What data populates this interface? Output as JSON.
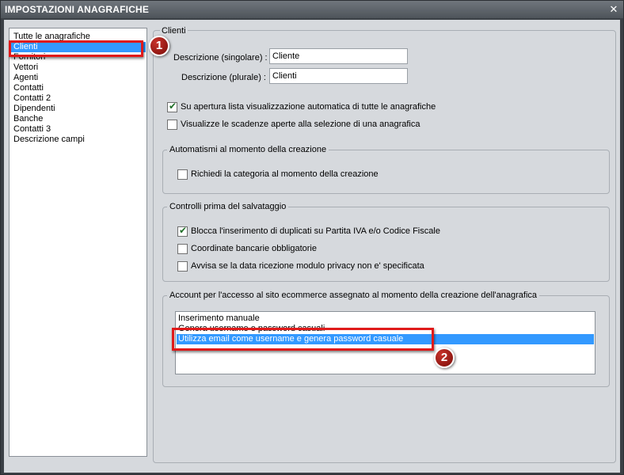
{
  "window": {
    "title": "IMPOSTAZIONI ANAGRAFICHE",
    "close_glyph": "✕"
  },
  "sidebar": {
    "items": [
      {
        "label": "Tutte le anagrafiche"
      },
      {
        "label": "Clienti",
        "selected": true
      },
      {
        "label": "Fornitori"
      },
      {
        "label": "Vettori"
      },
      {
        "label": "Agenti"
      },
      {
        "label": "Contatti"
      },
      {
        "label": "Contatti 2"
      },
      {
        "label": "Dipendenti"
      },
      {
        "label": "Banche"
      },
      {
        "label": "Contatti 3"
      },
      {
        "label": "Descrizione campi"
      }
    ]
  },
  "clienti": {
    "legend": "Clienti",
    "singolare_label": "Descrizione (singolare) :",
    "singolare_value": "Cliente",
    "plurale_label": "Descrizione (plurale) :",
    "plurale_value": "Clienti",
    "options": [
      {
        "label": "Su apertura lista visualizzazione automatica di tutte le anagrafiche",
        "checked": true
      },
      {
        "label": "Visualizze le scadenze aperte alla selezione di una anagrafica",
        "checked": false
      }
    ]
  },
  "automatismi": {
    "legend": "Automatismi al momento della creazione",
    "options": [
      {
        "label": "Richiedi la categoria al momento della creazione",
        "checked": false
      }
    ]
  },
  "controlli": {
    "legend": "Controlli prima del salvataggio",
    "options": [
      {
        "label": "Blocca l'inserimento di duplicati su Partita IVA e/o Codice Fiscale",
        "checked": true
      },
      {
        "label": "Coordinate bancarie obbligatorie",
        "checked": false
      },
      {
        "label": "Avvisa se la data ricezione modulo privacy non e' specificata",
        "checked": false
      }
    ]
  },
  "account": {
    "legend": "Account per l'accesso al sito ecommerce assegnato al momento della creazione dell'anagrafica",
    "items": [
      {
        "label": "Inserimento manuale"
      },
      {
        "label": "Genera username e password casuali"
      },
      {
        "label": "Utilizza email come username e genera password casuale",
        "selected": true
      }
    ]
  },
  "annotations": {
    "badge1": "1",
    "badge2": "2"
  },
  "colors": {
    "selection": "#3399ff",
    "highlight": "#e01a1a",
    "badge": "#a81e17"
  },
  "icons": {
    "close": "close-icon",
    "check": "checkmark-icon"
  }
}
